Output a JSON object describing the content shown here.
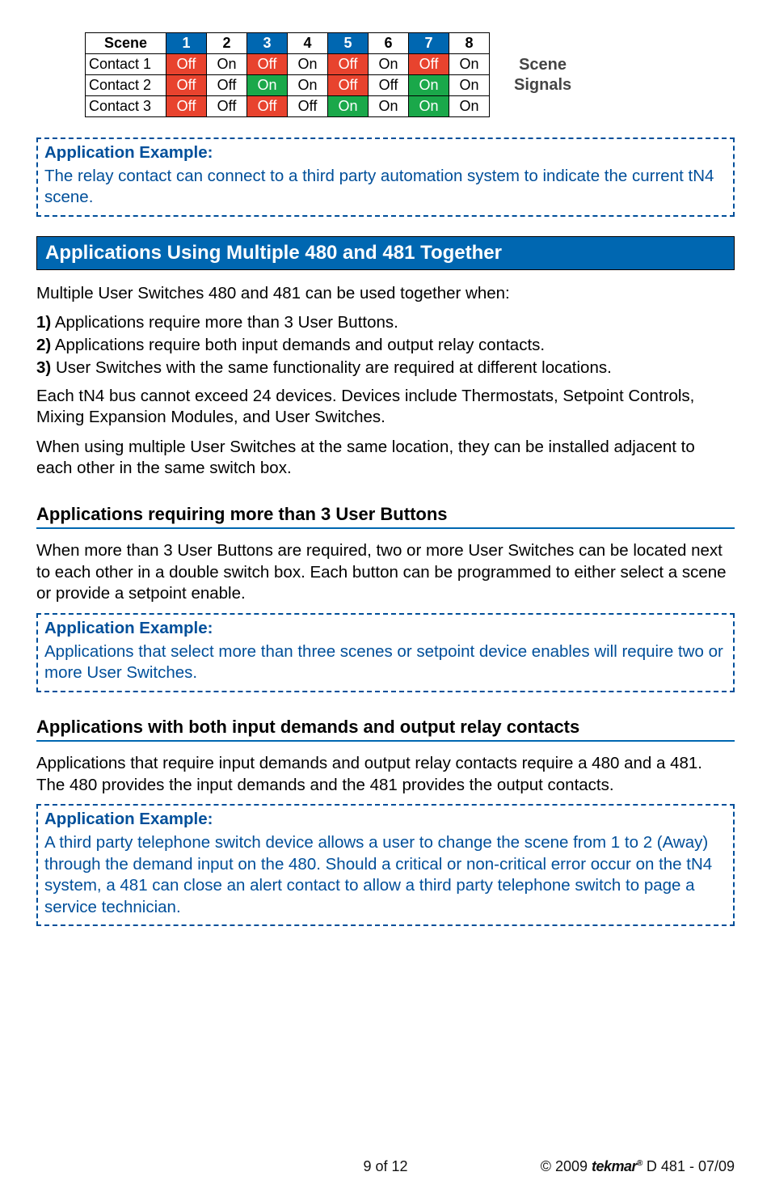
{
  "chart_data": {
    "type": "table",
    "title": "Scene Signals",
    "columns": [
      "Scene",
      "1",
      "2",
      "3",
      "4",
      "5",
      "6",
      "7",
      "8"
    ],
    "rows": [
      {
        "label": "Contact 1",
        "values": [
          "Off",
          "On",
          "Off",
          "On",
          "Off",
          "On",
          "Off",
          "On"
        ]
      },
      {
        "label": "Contact 2",
        "values": [
          "Off",
          "Off",
          "On",
          "On",
          "Off",
          "Off",
          "On",
          "On"
        ]
      },
      {
        "label": "Contact 3",
        "values": [
          "Off",
          "Off",
          "Off",
          "Off",
          "On",
          "On",
          "On",
          "On"
        ]
      }
    ]
  },
  "scene_table": {
    "header_label": "Scene",
    "columns": [
      "1",
      "2",
      "3",
      "4",
      "5",
      "6",
      "7",
      "8"
    ],
    "header_colors": [
      "blue",
      "",
      "blue",
      "",
      "blue",
      "",
      "blue",
      ""
    ],
    "rows": [
      {
        "label": "Contact 1",
        "cells": [
          {
            "v": "Off",
            "c": "red"
          },
          {
            "v": "On",
            "c": ""
          },
          {
            "v": "Off",
            "c": "red"
          },
          {
            "v": "On",
            "c": ""
          },
          {
            "v": "Off",
            "c": "red"
          },
          {
            "v": "On",
            "c": ""
          },
          {
            "v": "Off",
            "c": "red"
          },
          {
            "v": "On",
            "c": ""
          }
        ]
      },
      {
        "label": "Contact 2",
        "cells": [
          {
            "v": "Off",
            "c": "red"
          },
          {
            "v": "Off",
            "c": ""
          },
          {
            "v": "On",
            "c": "green"
          },
          {
            "v": "On",
            "c": ""
          },
          {
            "v": "Off",
            "c": "red"
          },
          {
            "v": "Off",
            "c": ""
          },
          {
            "v": "On",
            "c": "green"
          },
          {
            "v": "On",
            "c": ""
          }
        ]
      },
      {
        "label": "Contact 3",
        "cells": [
          {
            "v": "Off",
            "c": "red"
          },
          {
            "v": "Off",
            "c": ""
          },
          {
            "v": "Off",
            "c": "red"
          },
          {
            "v": "Off",
            "c": ""
          },
          {
            "v": "On",
            "c": "green"
          },
          {
            "v": "On",
            "c": ""
          },
          {
            "v": "On",
            "c": "green"
          },
          {
            "v": "On",
            "c": ""
          }
        ]
      }
    ],
    "side_label_line1": "Scene",
    "side_label_line2": "Signals"
  },
  "app_ex1": {
    "title": "Application Example:",
    "body": "The relay contact can connect to a third party automation system to indicate the current tN4 scene."
  },
  "section_band": "Applications Using Multiple 480 and 481 Together",
  "intro_line": "Multiple User Switches 480 and 481 can be used together when:",
  "list": {
    "n1": "1)",
    "t1": "Applications require more than 3 User Buttons.",
    "n2": "2)",
    "t2": "Applications require both input demands and output relay contacts.",
    "n3": "3)",
    "t3": "User Switches with the same functionality are required at different locations."
  },
  "para1": "Each tN4 bus cannot exceed 24 devices. Devices include Thermostats, Setpoint Controls, Mixing Expansion Modules, and User Switches.",
  "para2": "When using multiple User Switches at the same location, they can be installed adjacent to each other in the same switch box.",
  "sub1": "Applications requiring more than 3 User Buttons",
  "sub1_body": "When more than 3 User Buttons are required, two or more User Switches can be located next to each other in a double switch box. Each button can be programmed to either select a scene or provide a setpoint enable.",
  "app_ex2": {
    "title": "Application Example:",
    "body": "Applications that select more than three scenes or setpoint device enables will require two or more User Switches."
  },
  "sub2": "Applications with both input demands and output relay contacts",
  "sub2_body": "Applications that require input demands and output relay contacts require a 480 and a 481. The 480 provides the input demands and the 481 provides the output contacts.",
  "app_ex3": {
    "title": "Application Example:",
    "body": "A third party telephone switch device allows a user to change the scene from 1 to 2 (Away) through the demand input on the 480. Should a critical or non-critical error occur on the tN4 system, a 481 can close an alert contact to allow a third party telephone switch to page a service technician."
  },
  "footer": {
    "page": "9 of 12",
    "copyright_prefix": "© 2009 ",
    "brand": "tekmar",
    "reg": "®",
    "docid": " D 481 - 07/09"
  }
}
